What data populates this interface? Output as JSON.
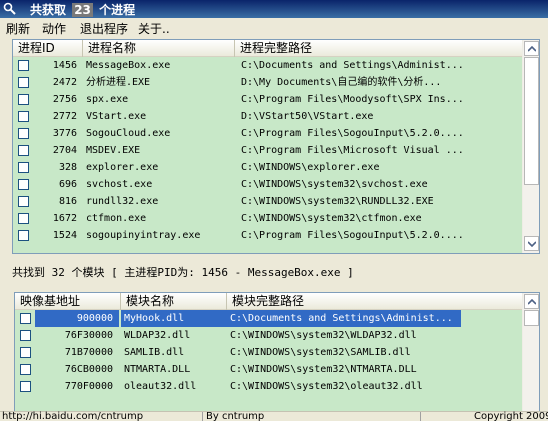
{
  "window": {
    "title_prefix": "共获取",
    "title_count": "23",
    "title_suffix": "个进程"
  },
  "menu": [
    "刷新",
    "动作",
    "退出程序",
    "关于.."
  ],
  "process_table": {
    "columns": [
      "进程ID",
      "进程名称",
      "进程完整路径"
    ],
    "rows": [
      {
        "pid": "1456",
        "name": "MessageBox.exe",
        "path": "C:\\Documents and Settings\\Administ..."
      },
      {
        "pid": "2472",
        "name": "分析进程.EXE",
        "path": "D:\\My Documents\\自己编的软件\\分析..."
      },
      {
        "pid": "2756",
        "name": "spx.exe",
        "path": "C:\\Program Files\\Moodysoft\\SPX Ins..."
      },
      {
        "pid": "2772",
        "name": "VStart.exe",
        "path": "D:\\VStart50\\VStart.exe"
      },
      {
        "pid": "3776",
        "name": "SogouCloud.exe",
        "path": "C:\\Program Files\\SogouInput\\5.2.0...."
      },
      {
        "pid": "2704",
        "name": "MSDEV.EXE",
        "path": "C:\\Program Files\\Microsoft Visual ..."
      },
      {
        "pid": "328",
        "name": "explorer.exe",
        "path": "C:\\WINDOWS\\explorer.exe"
      },
      {
        "pid": "696",
        "name": "svchost.exe",
        "path": "C:\\WINDOWS\\system32\\svchost.exe"
      },
      {
        "pid": "816",
        "name": "rundll32.exe",
        "path": "C:\\WINDOWS\\system32\\RUNDLL32.EXE"
      },
      {
        "pid": "1672",
        "name": "ctfmon.exe",
        "path": "C:\\WINDOWS\\system32\\ctfmon.exe"
      },
      {
        "pid": "1524",
        "name": "sogoupinyintray.exe",
        "path": "C:\\Program Files\\SogouInput\\5.2.0...."
      }
    ]
  },
  "module_summary": "共找到 32 个模块 [ 主进程PID为: 1456 - MessageBox.exe ]",
  "module_table": {
    "columns": [
      "映像基地址",
      "模块名称",
      "模块完整路径"
    ],
    "rows": [
      {
        "base": "900000",
        "name": "MyHook.dll",
        "path": "C:\\Documents and Settings\\Administ...",
        "selected": true
      },
      {
        "base": "76F30000",
        "name": "WLDAP32.dll",
        "path": "C:\\WINDOWS\\system32\\WLDAP32.dll"
      },
      {
        "base": "71B70000",
        "name": "SAMLIB.dll",
        "path": "C:\\WINDOWS\\system32\\SAMLIB.dll"
      },
      {
        "base": "76CB0000",
        "name": "NTMARTA.DLL",
        "path": "C:\\WINDOWS\\system32\\NTMARTA.DLL"
      },
      {
        "base": "770F0000",
        "name": "oleaut32.dll",
        "path": "C:\\WINDOWS\\system32\\oleaut32.dll"
      }
    ]
  },
  "status": {
    "link": "http://hi.baidu.com/cntrump",
    "author": "By cntrump",
    "copyright": "Copyright 2009"
  }
}
